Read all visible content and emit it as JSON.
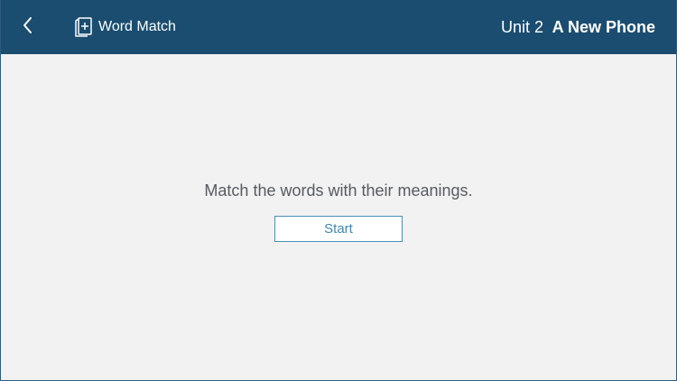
{
  "header": {
    "back_icon": "chevron-left-icon",
    "activity_icon": "flashcard-plus-icon",
    "activity_title": "Word Match",
    "unit_label": "Unit 2",
    "lesson_title": "A New Phone"
  },
  "main": {
    "instruction": "Match the words with their meanings.",
    "start_label": "Start"
  },
  "colors": {
    "header_background": "#1a4d70",
    "page_background": "#f2f2f2",
    "accent": "#3f87b0",
    "text": "#555b61"
  }
}
